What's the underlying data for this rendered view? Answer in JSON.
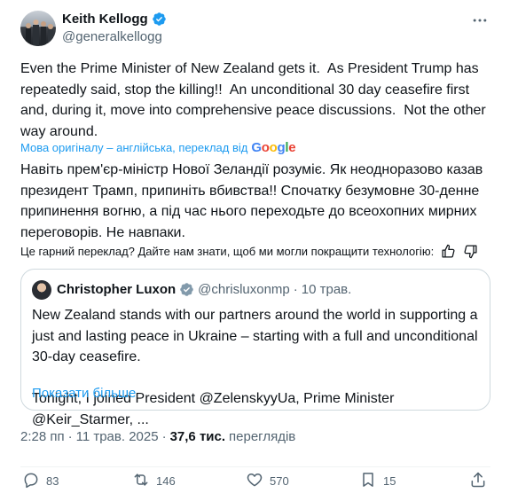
{
  "author": {
    "name": "Keith Kellogg",
    "handle": "@generalkellogg"
  },
  "post": {
    "text": "Even the Prime Minister of New Zealand gets it.  As President Trump has repeatedly said, stop the killing!!  An unconditional 30 day ceasefire first and, during it, move into comprehensive peace discussions.  Not the other way around.",
    "translation_credit": "Мова оригіналу – англійська, переклад від",
    "translation_provider": "Google",
    "translated_text": "Навіть прем'єр-міністр Нової Зеландії розуміє. Як неодноразово казав президент Трамп, припиніть вбивства!! Спочатку безумовне 30-денне припинення вогню, а під час нього переходьте до всеохопних мирних переговорів. Не навпаки.",
    "feedback_prompt": "Це гарний переклад? Дайте нам знати, щоб ми могли покращити технологію:"
  },
  "quote": {
    "name": "Christopher Luxon",
    "handle": "@chrisluxonmp",
    "separator": "·",
    "date": "10 трав.",
    "text": "New Zealand stands with our partners around the world in supporting a just and lasting peace in Ukraine – starting with a full and unconditional 30-day ceasefire.\n\nTonight, I joined President @ZelenskyyUa, Prime Minister @Keir_Starmer, ...",
    "show_more": "Показати більше"
  },
  "meta": {
    "time": "2:28 пп",
    "separator": "·",
    "date": "11 трав. 2025",
    "views_count": "37,6 тис.",
    "views_label": "переглядів"
  },
  "actions": {
    "replies": "83",
    "reposts": "146",
    "likes": "570",
    "bookmarks": "15"
  },
  "colors": {
    "accent": "#1d9bf0",
    "text": "#0f1419",
    "secondary": "#536471",
    "border": "#cfd9de"
  },
  "icons": [
    "verified-badge-icon",
    "more-options-icon",
    "thumbs-up-icon",
    "thumbs-down-icon",
    "reply-icon",
    "repost-icon",
    "like-icon",
    "bookmark-icon",
    "share-icon"
  ]
}
